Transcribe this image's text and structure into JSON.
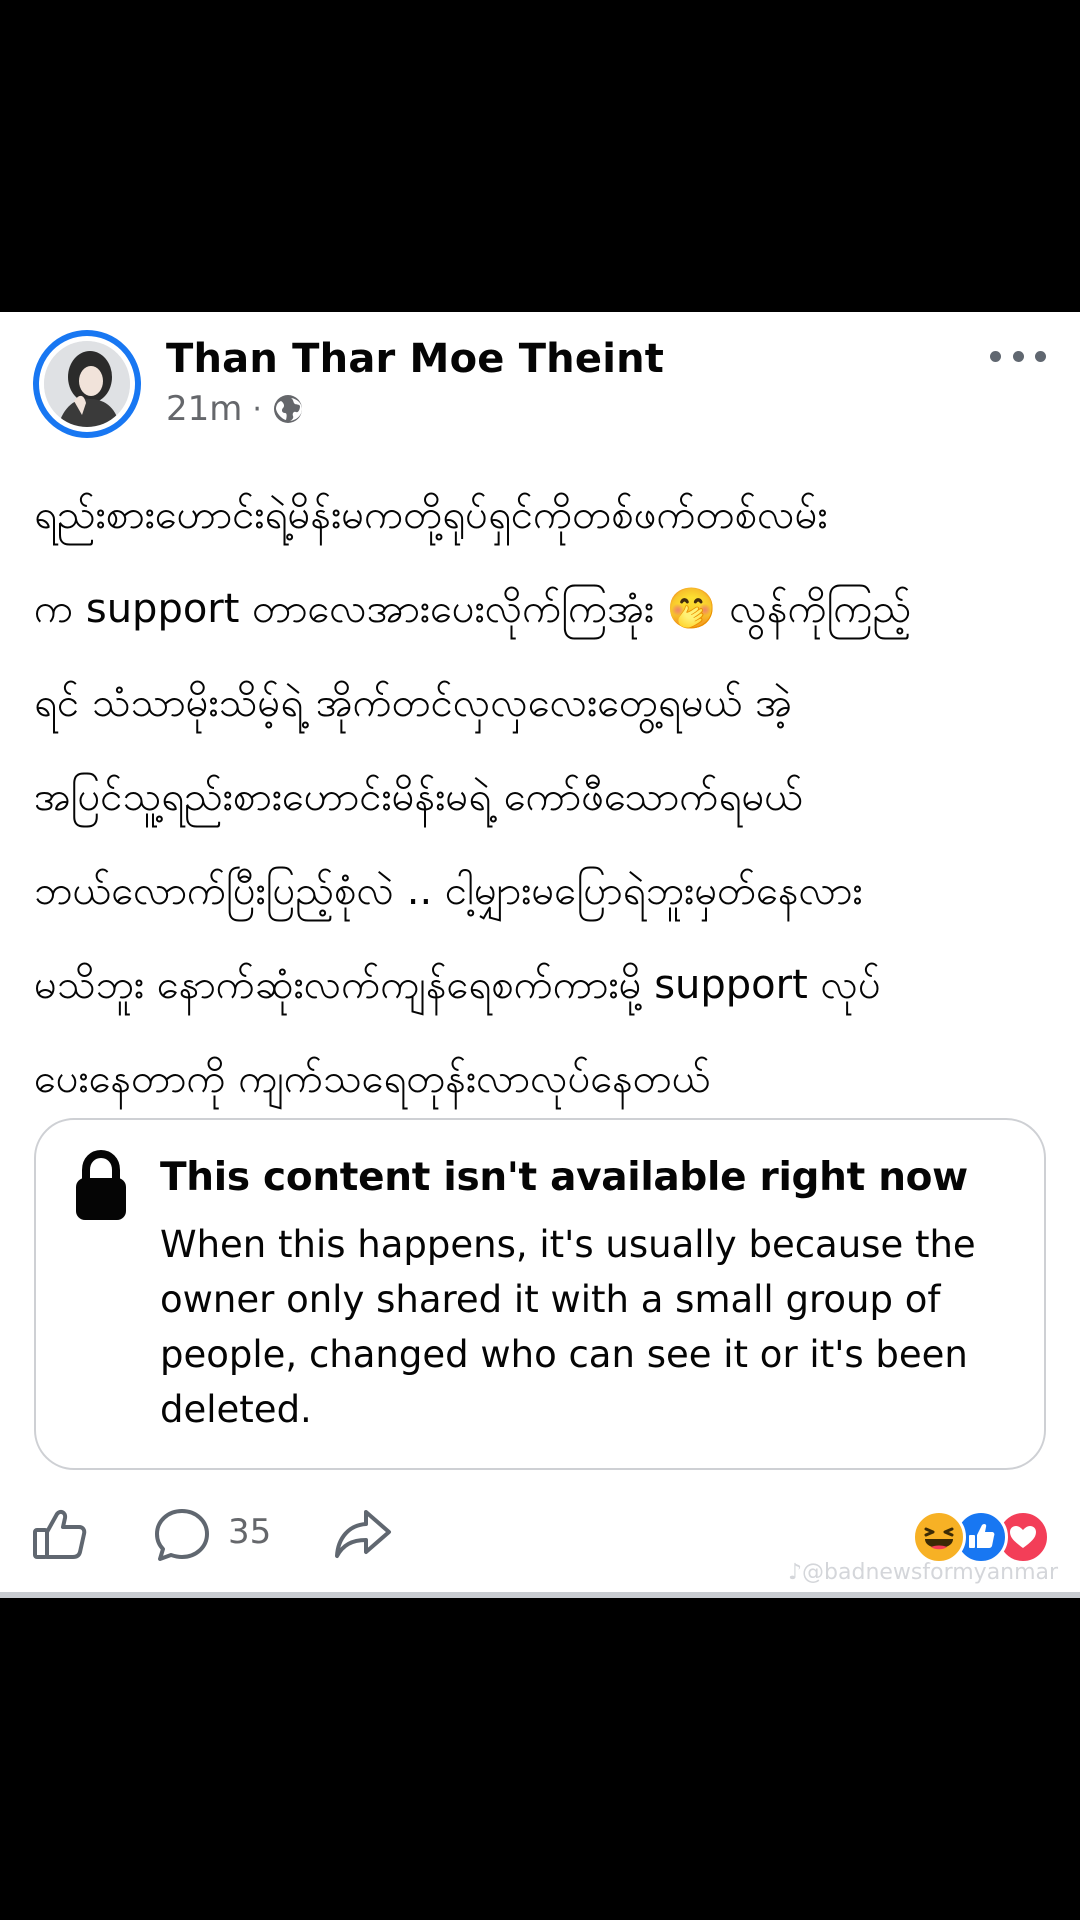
{
  "post": {
    "author": "Than Thar Moe Theint",
    "time": "21m",
    "separator": "·",
    "audience_icon": "globe-icon",
    "text": "ရည်းစားဟောင်းရဲ့မိန်းမကတို့ရုပ်ရှင်ကိုတစ်ဖက်တစ်လမ်း\nက support တာလေအားပေးလိုက်ကြအုံး 🤭 လွန်ကိုကြည့်\nရင် သံသာမိုးသိမ့်ရဲ့ အိုက်တင်လှလှလေးတွေ့ရမယ် အဲ့\nအပြင်သူ့ရည်းစားဟောင်းမိန်းမရဲ့ ကော်ဖီသောက်ရမယ်\nဘယ်လောက်ပြီးပြည့်စုံလဲ .. ငါ့မျှားမပြောရဲဘူးမှတ်နေလား\nမသိဘူး နောက်ဆုံးလက်ကျန်ရေစက်ကားမို့ support လုပ်\nပေးနေတာကို ကျက်သရေတုန်းလာလုပ်နေတယ်"
  },
  "unavailable": {
    "title": "This content isn't available right now",
    "body": "When this happens, it's usually because the owner only shared it with a small group of people, changed who can see it or it's been deleted."
  },
  "actions": {
    "like_icon": "thumbs-up-icon",
    "comment_icon": "comment-icon",
    "comment_count": "35",
    "share_icon": "share-icon"
  },
  "reactions": [
    "haha-icon",
    "like-icon",
    "love-icon"
  ],
  "colors": {
    "accent": "#1877f2",
    "love": "#f33e58",
    "haha": "#f7b125",
    "secondary_text": "#65676b"
  },
  "watermark": "♪@badnewsformyanmar"
}
